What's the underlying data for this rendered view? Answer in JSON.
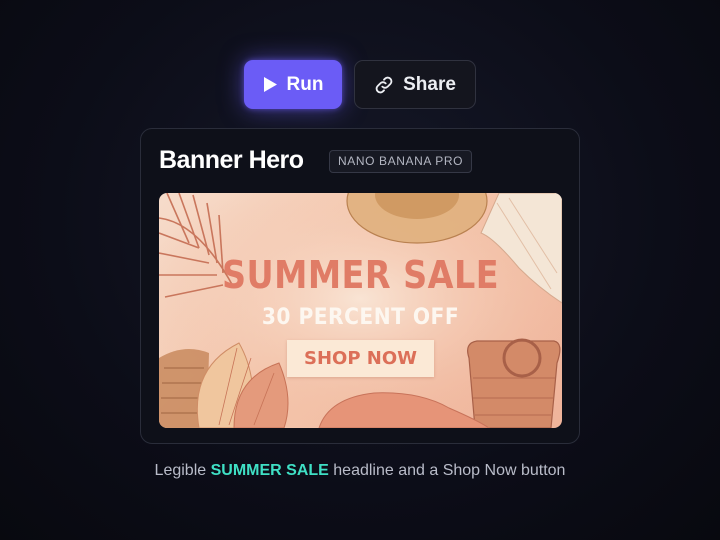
{
  "toolbar": {
    "run_label": "Run",
    "share_label": "Share",
    "run_icon": "play-icon",
    "share_icon": "link-icon"
  },
  "card": {
    "title": "Banner Hero",
    "model_badge": "NANO BANANA PRO",
    "banner": {
      "headline": "SUMMER SALE",
      "subheadline": "30 PERCENT OFF",
      "cta": "SHOP NOW"
    }
  },
  "caption": {
    "prefix": "Legible ",
    "highlight": "SUMMER SALE",
    "suffix": " headline and a Shop Now button"
  },
  "colors": {
    "accent": "#6b5cf6",
    "highlight": "#3fe0c5",
    "background": "#0c0d18",
    "banner_text": "#e07c66"
  }
}
